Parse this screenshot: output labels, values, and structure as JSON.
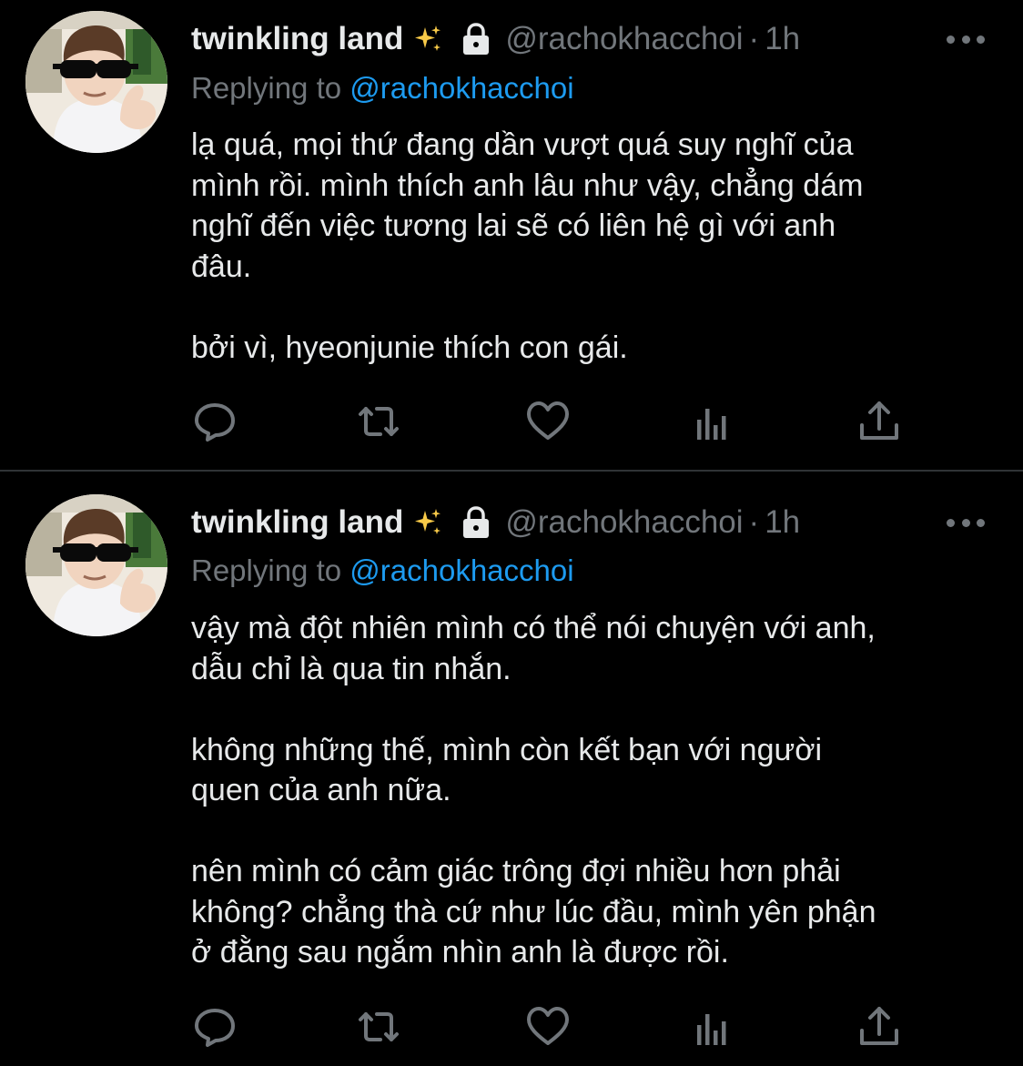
{
  "tweets": [
    {
      "author": {
        "name": "twinkling land",
        "handle": "@rachokhacchoi"
      },
      "separator": "·",
      "time": "1h",
      "reply": {
        "prefix": "Replying to ",
        "mention": "@rachokhacchoi"
      },
      "text": "lạ quá, mọi thứ đang dần vượt quá suy nghĩ của\nmình rồi. mình thích anh lâu như vậy, chẳng dám\nnghĩ đến việc tương lai sẽ có liên hệ gì với anh\nđâu.\n\nbởi vì, hyeonjunie thích con gái."
    },
    {
      "author": {
        "name": "twinkling land",
        "handle": "@rachokhacchoi"
      },
      "separator": "·",
      "time": "1h",
      "reply": {
        "prefix": "Replying to ",
        "mention": "@rachokhacchoi"
      },
      "text": "vậy mà đột nhiên mình có thể nói chuyện với anh,\ndẫu chỉ là qua tin nhắn.\n\nkhông những thế, mình còn kết bạn với người\nquen của anh nữa.\n\nnên mình có cảm giác trông đợi nhiều hơn phải\nkhông? chẳng thà cứ như lúc đầu, mình yên phận\nở đằng sau ngắm nhìn anh là được rồi."
    }
  ],
  "icons": [
    "sparkles-icon",
    "lock-icon",
    "more-icon",
    "reply-icon",
    "retweet-icon",
    "like-icon",
    "views-icon",
    "share-icon"
  ],
  "colors": {
    "background": "#000000",
    "text": "#e7e9ea",
    "muted": "#71767b",
    "accent": "#1d9bf0",
    "divider": "#2f3336"
  }
}
